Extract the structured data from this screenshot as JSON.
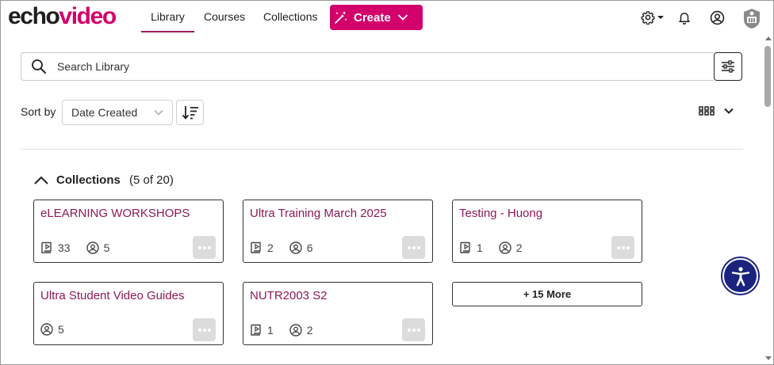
{
  "header": {
    "logo_part1": "echo",
    "logo_part2": "video",
    "nav": [
      {
        "label": "Library",
        "active": true
      },
      {
        "label": "Courses",
        "active": false
      },
      {
        "label": "Collections",
        "active": false
      }
    ],
    "create_label": "Create",
    "icons": [
      "wand-icon",
      "chevron-down-icon",
      "gear-icon",
      "bell-icon",
      "user-icon",
      "app-badge-icon"
    ]
  },
  "search": {
    "placeholder": "Search Library"
  },
  "sort": {
    "label": "Sort by",
    "selected": "Date Created"
  },
  "collections": {
    "title": "Collections",
    "count": "(5 of 20)",
    "cards": [
      {
        "title": "eLEARNING WORKSHOPS",
        "media": "33",
        "users": "5"
      },
      {
        "title": "Ultra Training March 2025",
        "media": "2",
        "users": "6"
      },
      {
        "title": "Testing - Huong",
        "media": "1",
        "users": "2"
      },
      {
        "title": "Ultra Student Video Guides",
        "users": "5"
      },
      {
        "title": "NUTR2003 S2",
        "media": "1",
        "users": "2"
      }
    ],
    "more_label": "+ 15 More"
  },
  "colors": {
    "brand": "#d3006b",
    "card_title": "#8f1857",
    "accessibility": "#1a237e"
  }
}
